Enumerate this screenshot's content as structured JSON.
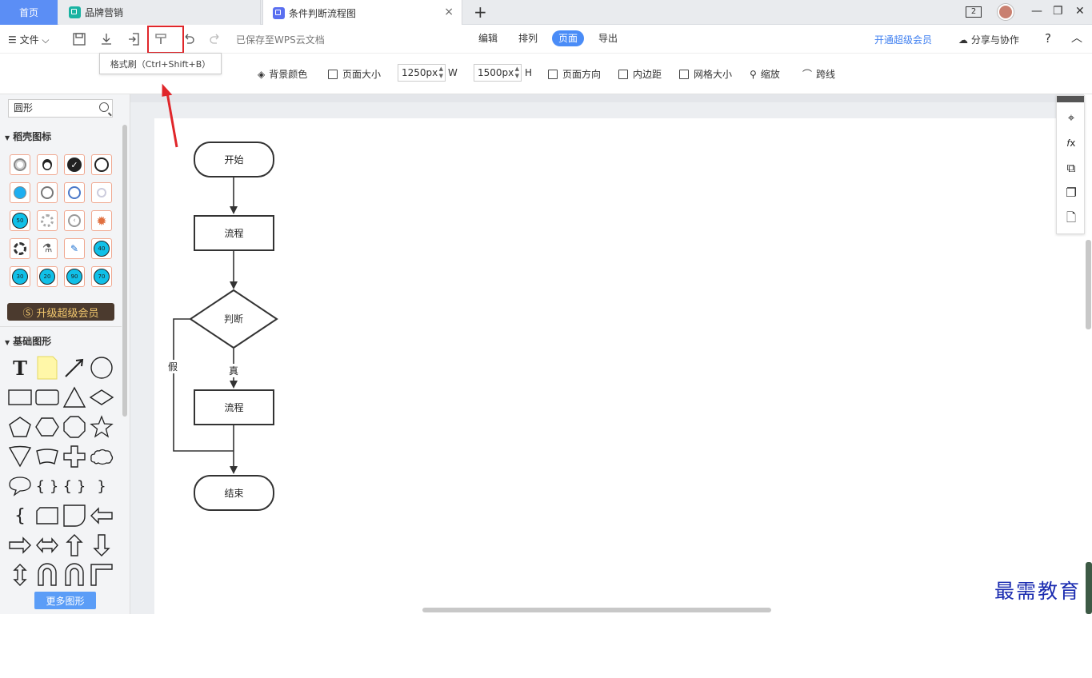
{
  "tabs": {
    "home": "首页",
    "tab1": "品牌营销",
    "tab2": "条件判断流程图",
    "close": "×",
    "add": "+"
  },
  "window": {
    "badge": "2",
    "minimize": "—",
    "restore": "❐",
    "close": "✕"
  },
  "toolbar": {
    "file_menu": "☰ 文件 ⌵",
    "saved_status": "已保存至WPS云文档",
    "center_tabs": [
      "编辑",
      "排列",
      "页面",
      "导出"
    ],
    "active_tab": "页面",
    "vip_link": "开通超级会员",
    "share": "分享与协作",
    "help": "?",
    "collapse": "︿",
    "icons": [
      "save-icon",
      "download-icon",
      "export-icon",
      "format-painter-icon",
      "undo-icon",
      "redo-icon"
    ]
  },
  "tooltip": {
    "text": "格式刷（Ctrl+Shift+B）"
  },
  "pagebar": {
    "bg_color": "背景颜色",
    "page_size": "页面大小",
    "width_value": "1250px",
    "width_suffix": "W",
    "height_value": "1500px",
    "height_suffix": "H",
    "orientation": "页面方向",
    "padding": "内边距",
    "grid_size": "网格大小",
    "zoom": "缩放",
    "jump_line": "跨线"
  },
  "leftpanel": {
    "search_value": "圆形",
    "section_daoke": "稻壳图标",
    "section_basic": "基础图形",
    "vip_button": "升级超级会员",
    "more_button": "更多图形",
    "daoke_labels": [
      "50",
      "40",
      "30",
      "20",
      "90",
      "70"
    ]
  },
  "flowchart": {
    "start": "开始",
    "process1": "流程",
    "decision": "判断",
    "true_label": "真",
    "false_label": "假",
    "process2": "流程",
    "end": "结束"
  },
  "watermark": "最需教育",
  "colors": {
    "accent": "#4a8cf7",
    "highlight": "#e0262a",
    "home_tab": "#5b8ef5"
  }
}
